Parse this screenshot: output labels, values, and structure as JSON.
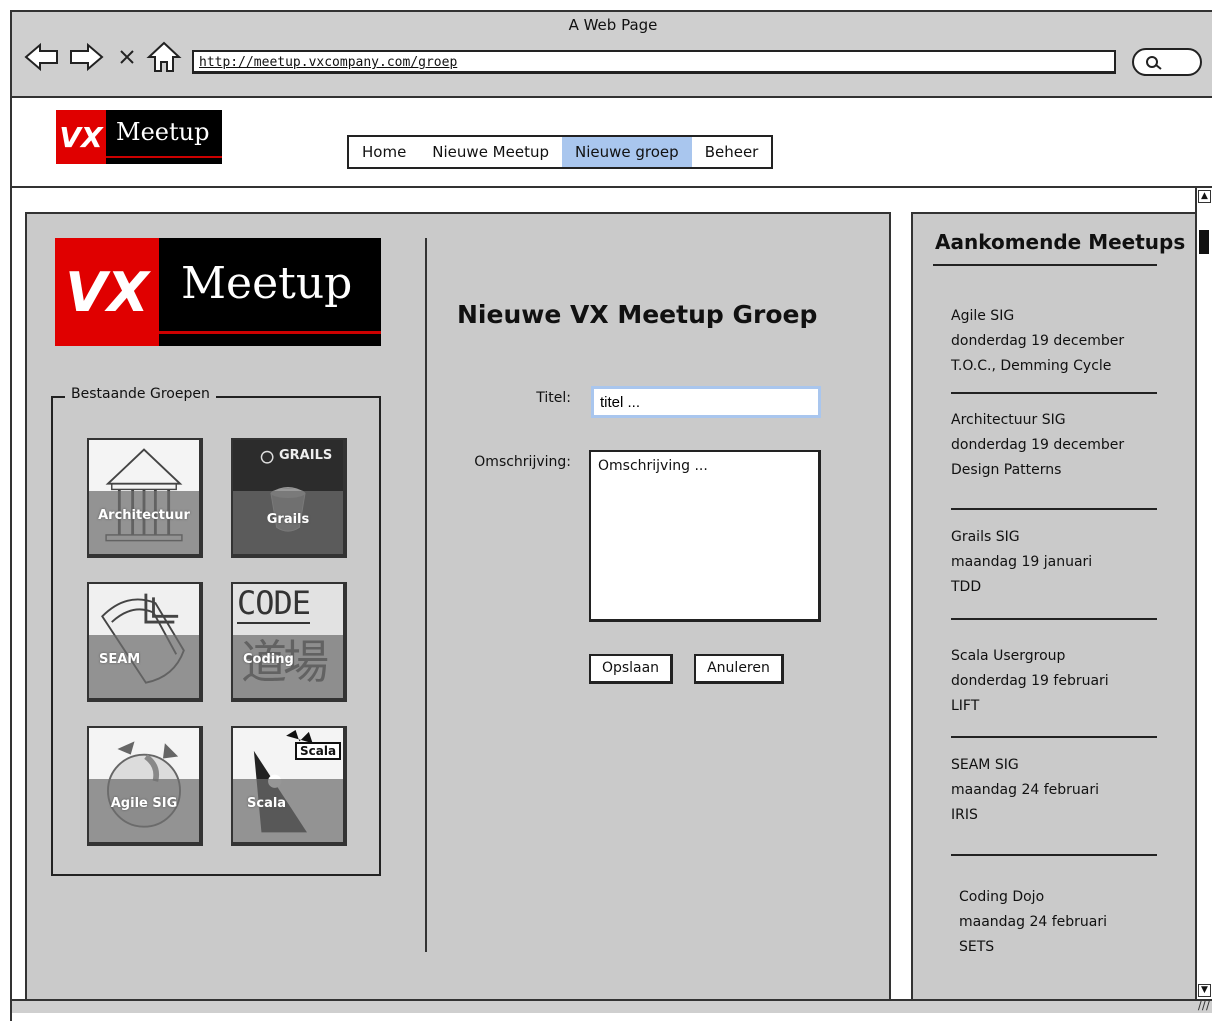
{
  "window": {
    "title": "A Web Page"
  },
  "browser": {
    "url": "http://meetup.vxcompany.com/groep",
    "icons": [
      "back-arrow-icon",
      "forward-arrow-icon",
      "close-icon",
      "home-icon",
      "search-icon"
    ]
  },
  "header": {
    "logo": {
      "vx": "VX",
      "word": "Meetup"
    },
    "nav": [
      {
        "label": "Home",
        "active": false
      },
      {
        "label": "Nieuwe Meetup",
        "active": false
      },
      {
        "label": "Nieuwe groep",
        "active": true
      },
      {
        "label": "Beheer",
        "active": false
      }
    ]
  },
  "main": {
    "logo": {
      "vx": "VX",
      "word": "Meetup"
    },
    "groups_legend": "Bestaande Groepen",
    "groups": [
      {
        "label": "Architectuur",
        "art": "temple"
      },
      {
        "label": "Grails",
        "art": "grails",
        "art_text": "GRAILS"
      },
      {
        "label": "SEAM",
        "art": "seam"
      },
      {
        "label": "Coding",
        "art": "code",
        "art_text": "CODE",
        "art_glyphs": "道場"
      },
      {
        "label": "Agile SIG",
        "art": "agile"
      },
      {
        "label": "Scala",
        "art": "scala",
        "art_text": "Scala"
      }
    ],
    "form": {
      "title": "Nieuwe VX Meetup Groep",
      "titel_label": "Titel:",
      "titel_value": "titel ...",
      "omschrijving_label": "Omschrijving:",
      "omschrijving_value": "Omschrijving ...",
      "save_label": "Opslaan",
      "cancel_label": "Anuleren"
    }
  },
  "sidebar": {
    "title": "Aankomende Meetups",
    "meetups": [
      {
        "name": "Agile SIG",
        "date": "donderdag 19 december",
        "topic": "T.O.C., Demming Cycle"
      },
      {
        "name": "Architectuur SIG",
        "date": "donderdag 19 december",
        "topic": "Design Patterns"
      },
      {
        "name": "Grails SIG",
        "date": "maandag 19 januari",
        "topic": "TDD"
      },
      {
        "name": "Scala Usergroup",
        "date": "donderdag 19 februari",
        "topic": "LIFT"
      },
      {
        "name": "SEAM SIG",
        "date": "maandag 24 februari",
        "topic": "IRIS"
      },
      {
        "name": "Coding Dojo",
        "date": "maandag 24 februari",
        "topic": "SETS"
      }
    ]
  },
  "colors": {
    "accent": "#a9c6ee",
    "logo_red": "#e00000",
    "panel": "#cacaca"
  }
}
